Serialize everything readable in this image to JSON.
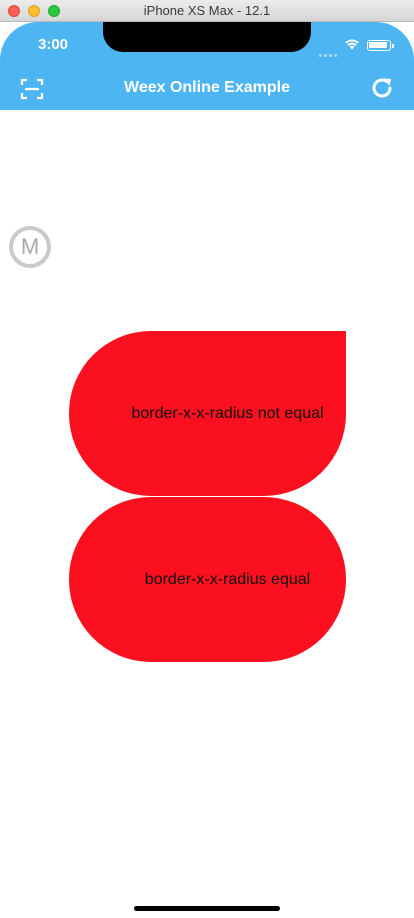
{
  "window": {
    "title": "iPhone XS Max - 12.1"
  },
  "status_bar": {
    "time": "3:00",
    "icons": [
      "signal-dots-icon",
      "wifi-icon",
      "battery-icon"
    ]
  },
  "navbar": {
    "title": "Weex Online Example",
    "left_icon": "scan-icon",
    "right_icon": "refresh-icon",
    "color": "#4db6f2"
  },
  "floating_button": {
    "label": "M"
  },
  "shapes": [
    {
      "text": "border-x-x-radius not equal",
      "color": "#fb101f"
    },
    {
      "text": "border-x-x-radius equal",
      "color": "#fb101f"
    }
  ]
}
